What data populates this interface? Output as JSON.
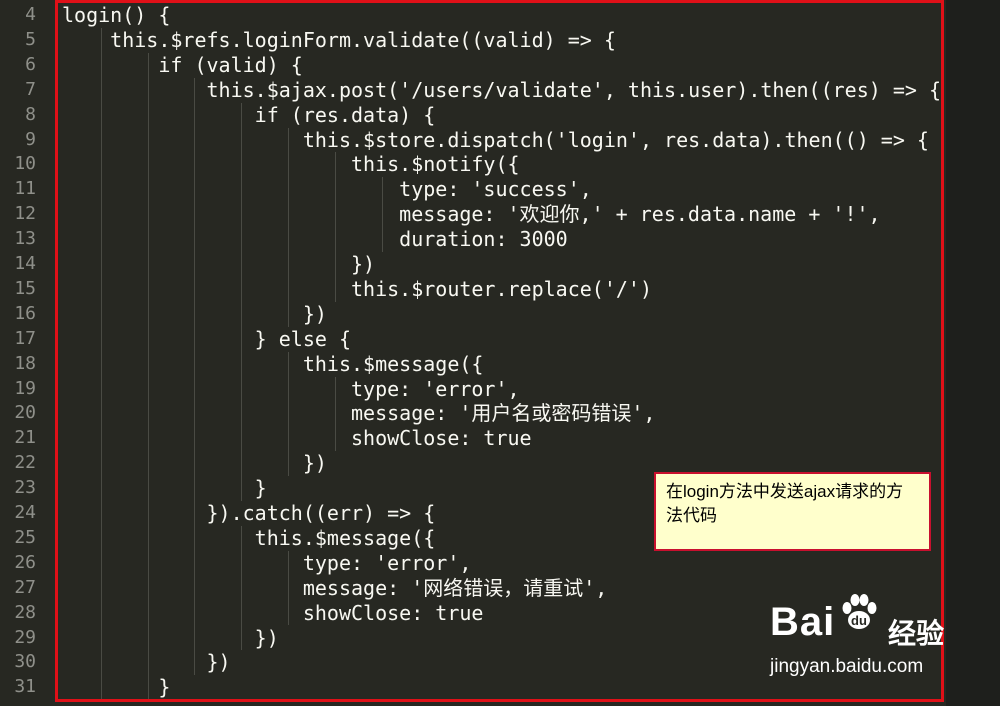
{
  "editor": {
    "line_numbers": [
      "4",
      "5",
      "6",
      "7",
      "8",
      "9",
      "10",
      "11",
      "12",
      "13",
      "14",
      "15",
      "16",
      "17",
      "18",
      "19",
      "20",
      "21",
      "22",
      "23",
      "24",
      "25",
      "26",
      "27",
      "28",
      "29",
      "30",
      "31"
    ],
    "lines": [
      "login() {",
      "    this.$refs.loginForm.validate((valid) => {",
      "        if (valid) {",
      "            this.$ajax.post('/users/validate', this.user).then((res) => {",
      "                if (res.data) {",
      "                    this.$store.dispatch('login', res.data).then(() => {",
      "                        this.$notify({",
      "                            type: 'success',",
      "                            message: '欢迎你,' + res.data.name + '!',",
      "                            duration: 3000",
      "                        })",
      "                        this.$router.replace('/')",
      "                    })",
      "                } else {",
      "                    this.$message({",
      "                        type: 'error',",
      "                        message: '用户名或密码错误',",
      "                        showClose: true",
      "                    })",
      "                }",
      "            }).catch((err) => {",
      "                this.$message({",
      "                    type: 'error',",
      "                    message: '网络错误，请重试',",
      "                    showClose: true",
      "                })",
      "            })",
      "        }"
    ],
    "colors": {
      "background": "#272822",
      "text": "#f8f8f2",
      "gutter_text": "#8f908a",
      "frame": "#e01018"
    }
  },
  "annotation": {
    "text": "在login方法中发送ajax请求的方法代码"
  },
  "watermark": {
    "logo_left": "Bai",
    "logo_right": "经验",
    "url": "jingyan.baidu.com"
  }
}
